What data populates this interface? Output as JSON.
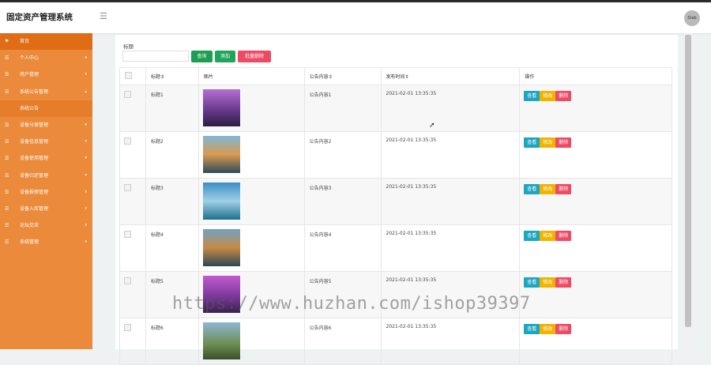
{
  "app": {
    "title": "固定资产管理系统",
    "menu_toggle_icon": "hamburger-icon",
    "avatar_text": "Stab"
  },
  "sidebar": {
    "items": [
      {
        "label": "首页",
        "icon": "flag-icon",
        "has_caret": false
      },
      {
        "label": "个人中心",
        "icon": "list-icon",
        "has_caret": true
      },
      {
        "label": "用户管理",
        "icon": "list-icon",
        "has_caret": true
      },
      {
        "label": "系统公告管理",
        "icon": "list-icon",
        "has_caret": true,
        "expanded": true
      },
      {
        "label": "系统公告",
        "sub": true
      },
      {
        "label": "设备分类管理",
        "icon": "list-icon",
        "has_caret": true
      },
      {
        "label": "设备信息管理",
        "icon": "list-icon",
        "has_caret": true
      },
      {
        "label": "设备使用管理",
        "icon": "list-icon",
        "has_caret": true
      },
      {
        "label": "设备归还管理",
        "icon": "list-icon",
        "has_caret": true
      },
      {
        "label": "设备报修管理",
        "icon": "list-icon",
        "has_caret": true
      },
      {
        "label": "设备入库管理",
        "icon": "list-icon",
        "has_caret": true
      },
      {
        "label": "论坛交流",
        "icon": "list-icon",
        "has_caret": true
      },
      {
        "label": "系统管理",
        "icon": "list-icon",
        "has_caret": true
      }
    ]
  },
  "search": {
    "label": "标题",
    "value": "",
    "placeholder": ""
  },
  "toolbar": {
    "query": "查询",
    "add": "添加",
    "batch_delete": "批量删除"
  },
  "table": {
    "headers": {
      "title": "标题",
      "image": "图片",
      "content": "公告内容",
      "time": "发布时间",
      "actions": "操作"
    },
    "rows": [
      {
        "title": "标题1",
        "content": "公告内容1",
        "time": "2021-02-01 13:35:35"
      },
      {
        "title": "标题2",
        "content": "公告内容2",
        "time": "2021-02-01 13:35:35"
      },
      {
        "title": "标题3",
        "content": "公告内容3",
        "time": "2021-02-01 13:35:35"
      },
      {
        "title": "标题4",
        "content": "公告内容4",
        "time": "2021-02-01 13:35:35"
      },
      {
        "title": "标题5",
        "content": "公告内容5",
        "time": "2021-02-01 13:35:35"
      },
      {
        "title": "标题6",
        "content": "公告内容6",
        "time": "2021-02-01 13:35:35"
      }
    ],
    "actions": {
      "view": "查看",
      "edit": "修改",
      "delete": "删除"
    }
  },
  "watermark": "https://www.huzhan.com/ishop39397",
  "colors": {
    "sidebar": "#ea8a3a",
    "sidebar_active": "#e06d15",
    "view": "#1ea5c0",
    "edit": "#f0b400",
    "delete": "#ef4a63",
    "query": "#1e9e52"
  }
}
